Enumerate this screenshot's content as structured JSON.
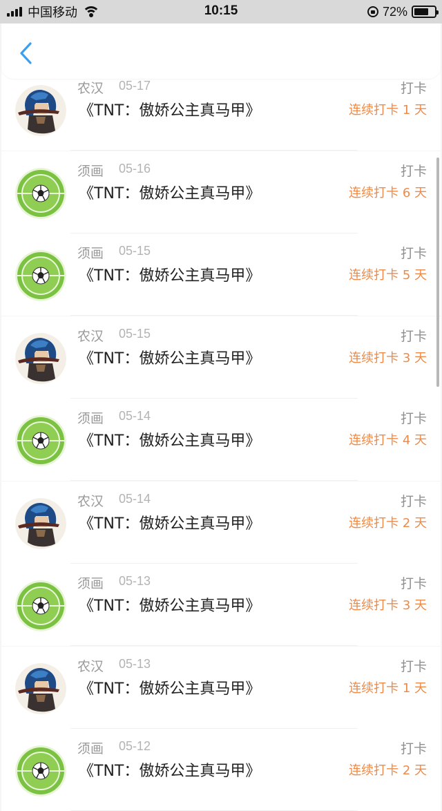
{
  "status_bar": {
    "carrier": "中国移动",
    "time": "10:15",
    "battery": "72%",
    "battery_level": 0.72
  },
  "colors": {
    "accent_blue": "#3a9ff0",
    "streak_orange": "#ee8a47"
  },
  "records": [
    {
      "user": "农汉",
      "date": "05-17",
      "book": "《TNT：傲娇公主真马甲》",
      "action": "打卡",
      "streak": "连续打卡 1 天",
      "avatar": "character-avatar"
    },
    {
      "user": "须画",
      "date": "05-16",
      "book": "《TNT：傲娇公主真马甲》",
      "action": "打卡",
      "streak": "连续打卡 6 天",
      "avatar": "soccer-avatar"
    },
    {
      "user": "须画",
      "date": "05-15",
      "book": "《TNT：傲娇公主真马甲》",
      "action": "打卡",
      "streak": "连续打卡 5 天",
      "avatar": "soccer-avatar"
    },
    {
      "user": "农汉",
      "date": "05-15",
      "book": "《TNT：傲娇公主真马甲》",
      "action": "打卡",
      "streak": "连续打卡 3 天",
      "avatar": "character-avatar"
    },
    {
      "user": "须画",
      "date": "05-14",
      "book": "《TNT：傲娇公主真马甲》",
      "action": "打卡",
      "streak": "连续打卡 4 天",
      "avatar": "soccer-avatar"
    },
    {
      "user": "农汉",
      "date": "05-14",
      "book": "《TNT：傲娇公主真马甲》",
      "action": "打卡",
      "streak": "连续打卡 2 天",
      "avatar": "character-avatar"
    },
    {
      "user": "须画",
      "date": "05-13",
      "book": "《TNT：傲娇公主真马甲》",
      "action": "打卡",
      "streak": "连续打卡 3 天",
      "avatar": "soccer-avatar"
    },
    {
      "user": "农汉",
      "date": "05-13",
      "book": "《TNT：傲娇公主真马甲》",
      "action": "打卡",
      "streak": "连续打卡 1 天",
      "avatar": "character-avatar"
    },
    {
      "user": "须画",
      "date": "05-12",
      "book": "《TNT：傲娇公主真马甲》",
      "action": "打卡",
      "streak": "连续打卡 2 天",
      "avatar": "soccer-avatar"
    }
  ]
}
